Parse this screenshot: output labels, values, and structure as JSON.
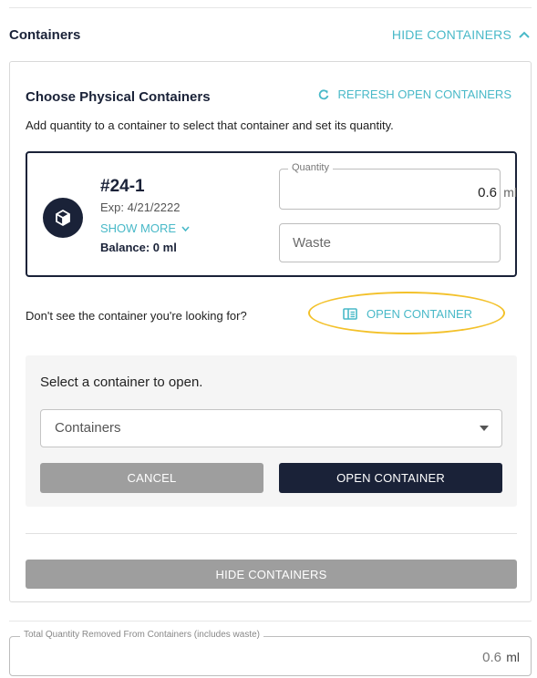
{
  "section": {
    "title": "Containers",
    "hide_link_label": "HIDE CONTAINERS"
  },
  "chooser": {
    "title": "Choose Physical Containers",
    "refresh_label": "REFRESH OPEN CONTAINERS",
    "helper_text": "Add quantity to a container to select that container and set its quantity."
  },
  "container_card": {
    "id": "#24-1",
    "exp": "Exp: 4/21/2222",
    "show_more_label": "SHOW MORE",
    "balance": "Balance: 0 ml",
    "quantity_legend": "Quantity",
    "quantity_value": "0.6",
    "quantity_unit": "ml",
    "waste_placeholder": "Waste"
  },
  "open_prompt": {
    "question": "Don't see the container you're looking for?",
    "open_container_label": "OPEN CONTAINER"
  },
  "open_panel": {
    "prompt": "Select a container to open.",
    "dropdown_value": "Containers",
    "cancel_label": "CANCEL",
    "open_label": "OPEN CONTAINER"
  },
  "footer": {
    "hide_button_label": "HIDE CONTAINERS",
    "total_legend": "Total Quantity Removed From Containers (includes waste)",
    "total_value": "0.6",
    "total_unit": "ml"
  },
  "colors": {
    "navy": "#1a2238",
    "accent": "#49b9c8",
    "highlight": "#f3c12a",
    "disabled_button": "#9e9e9e"
  },
  "icons": {
    "hide_chevron": "chevron-up-icon",
    "refresh": "refresh-icon",
    "container": "cube-icon",
    "show_more_chevron": "chevron-down-icon",
    "open_container": "open-container-icon",
    "dropdown": "caret-down-icon"
  }
}
